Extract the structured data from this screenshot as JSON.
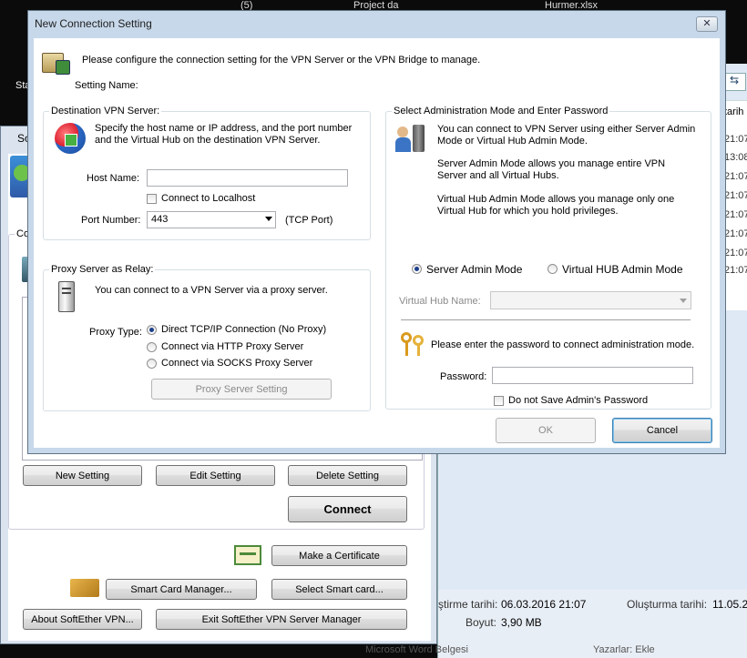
{
  "background": {
    "top_icons": [
      "Project da",
      "(5)",
      "Hurmer.xlsx"
    ],
    "desktop_text": "Sta",
    "explorer": {
      "column_header": "tarih",
      "times": [
        "21:07",
        "13:08",
        "21:07",
        "21:07",
        "21:07",
        "21:07",
        "21:07",
        "21:07"
      ],
      "created_label": "ştirme tarihi:",
      "created_value": "06.03.2016 21:07",
      "created2_label": "Oluşturma tarihi:",
      "created2_value": "11.05.20",
      "size_label": "Boyut:",
      "size_value": "3,90 MB",
      "bottom_left": "Microsoft Word Belgesi",
      "bottom_right": "Yazarlar: Ekle"
    }
  },
  "manager": {
    "title": "So",
    "group_label": "Co",
    "buttons": {
      "new_setting": "New Setting",
      "edit_setting": "Edit Setting",
      "delete_setting": "Delete Setting",
      "connect": "Connect",
      "make_certificate": "Make a Certificate",
      "smart_card_manager": "Smart Card Manager...",
      "select_smart_card": "Select Smart card...",
      "about": "About SoftEther VPN...",
      "exit": "Exit SoftEther VPN Server Manager"
    }
  },
  "dialog": {
    "title": "New Connection Setting",
    "close_glyph": "✕",
    "intro": "Please configure the connection setting for the VPN Server or the VPN Bridge to manage.",
    "setting_name_label": "Setting Name:",
    "destination": {
      "title": "Destination VPN Server:",
      "desc1": "Specify the host name or IP address, and the port number",
      "desc2": "and the Virtual Hub on the destination VPN Server.",
      "host_label": "Host Name:",
      "host_value": "",
      "localhost_label": "Connect to Localhost",
      "port_label": "Port Number:",
      "port_value": "443",
      "tcp_port": "(TCP Port)"
    },
    "proxy": {
      "title": "Proxy Server as Relay:",
      "desc": "You can connect to a VPN Server via a proxy server.",
      "type_label": "Proxy Type:",
      "options": [
        "Direct TCP/IP Connection (No Proxy)",
        "Connect via HTTP Proxy Server",
        "Connect via SOCKS Proxy Server"
      ],
      "selected": "Direct TCP/IP Connection (No Proxy)",
      "setting_button": "Proxy Server Setting"
    },
    "admin": {
      "title": "Select Administration Mode and Enter Password",
      "p1a": "You can connect to VPN Server using either Server Admin",
      "p1b": "Mode or Virtual Hub Admin Mode.",
      "p2a": "Server Admin Mode allows you manage entire VPN",
      "p2b": "Server and all Virtual Hubs.",
      "p3a": "Virtual Hub Admin Mode allows you manage only one",
      "p3b": "Virtual Hub for which you hold privileges.",
      "server_mode": "Server Admin Mode",
      "hub_mode": "Virtual HUB Admin Mode",
      "hub_name_label": "Virtual Hub Name:",
      "hub_name_value": "",
      "password_prompt": "Please enter the password to connect administration mode.",
      "password_label": "Password:",
      "password_value": "",
      "no_save_label": "Do not Save Admin's Password"
    },
    "ok_button": "OK",
    "cancel_button": "Cancel"
  }
}
